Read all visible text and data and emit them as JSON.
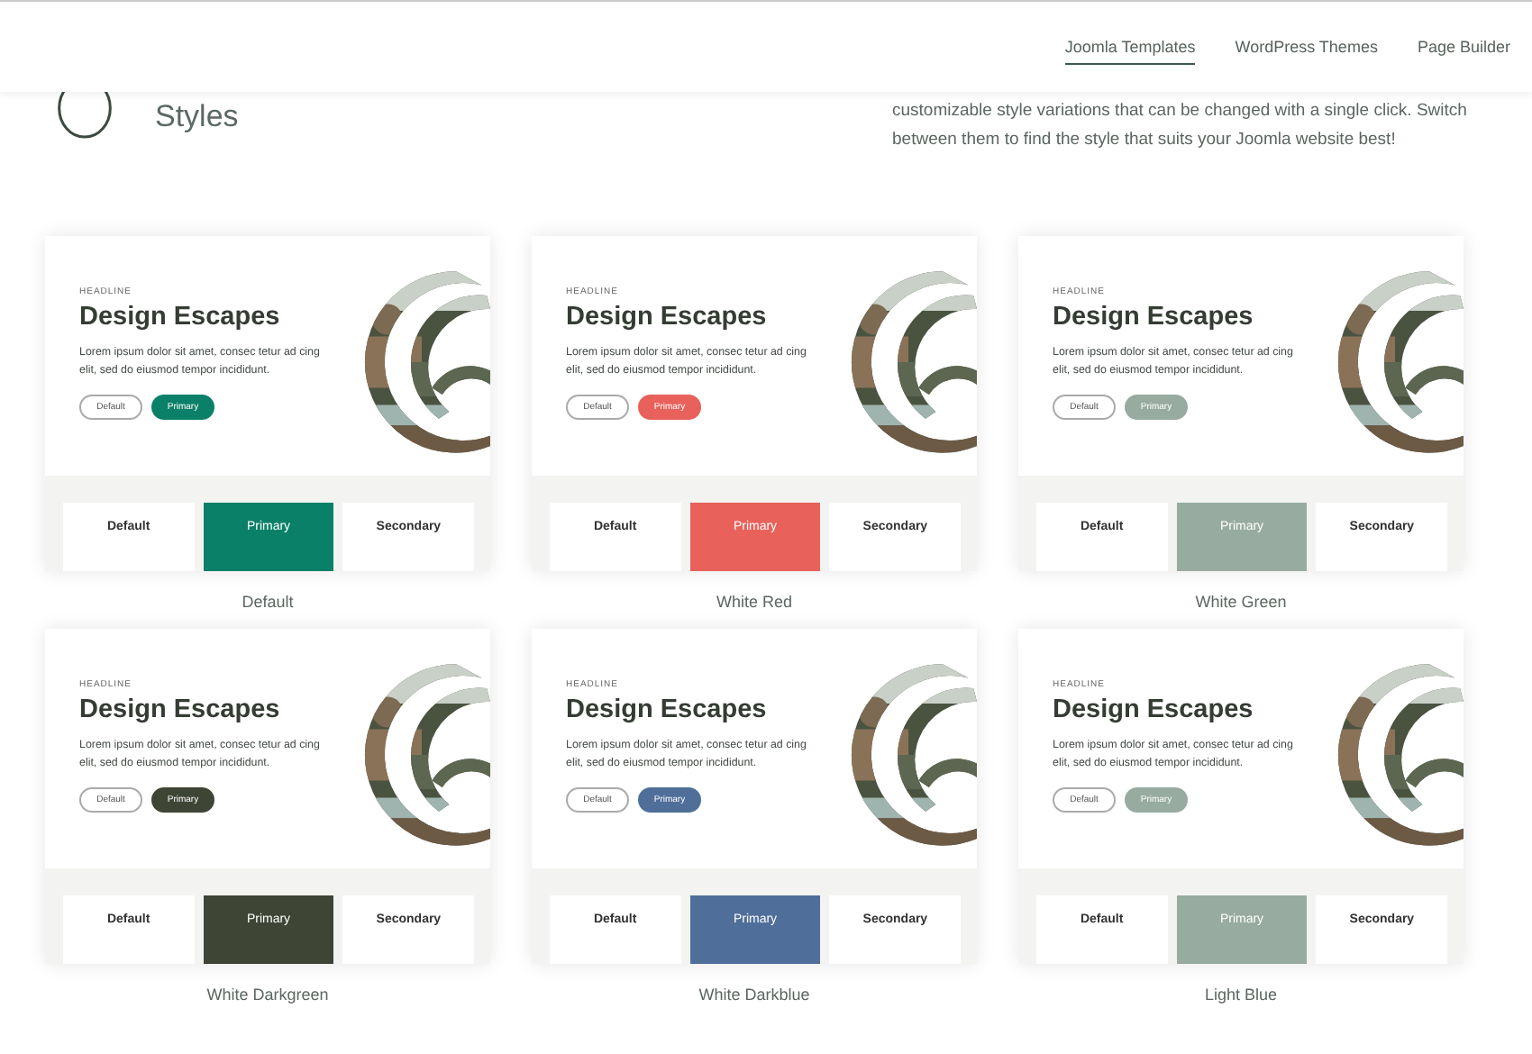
{
  "nav": [
    {
      "label": "Joomla Templates",
      "selected": true
    },
    {
      "label": "WordPress Themes",
      "selected": false
    },
    {
      "label": "Page Builder",
      "selected": false
    }
  ],
  "section": {
    "title": "Styles",
    "description": [
      "customizable style variations that can be changed with a single click. Switch",
      "between them to find the style that suits your Joomla website best!"
    ]
  },
  "styles": [
    {
      "name": "Default",
      "color": "#0b8068",
      "headline": "HEADLINE",
      "title": "Design Escapes",
      "body": "Lorem ipsum dolor sit amet, consec tetur ad cing elit, sed do eiusmod tempor incididunt.",
      "buttons": [
        {
          "label": "Default",
          "kind": "outline"
        },
        {
          "label": "Primary",
          "kind": "primary"
        }
      ],
      "swatches": [
        {
          "label": "Default",
          "kind": "plain"
        },
        {
          "label": "Primary",
          "kind": "primary"
        },
        {
          "label": "Secondary",
          "kind": "plain"
        }
      ]
    },
    {
      "name": "White Red",
      "color": "#e8615a",
      "headline": "HEADLINE",
      "title": "Design Escapes",
      "body": "Lorem ipsum dolor sit amet, consec tetur ad cing elit, sed do eiusmod tempor incididunt.",
      "buttons": [
        {
          "label": "Default",
          "kind": "outline"
        },
        {
          "label": "Primary",
          "kind": "primary"
        }
      ],
      "swatches": [
        {
          "label": "Default",
          "kind": "plain"
        },
        {
          "label": "Primary",
          "kind": "primary"
        },
        {
          "label": "Secondary",
          "kind": "plain"
        }
      ]
    },
    {
      "name": "White Green",
      "color": "#97aba0",
      "headline": "HEADLINE",
      "title": "Design Escapes",
      "body": "Lorem ipsum dolor sit amet, consec tetur ad cing elit, sed do eiusmod tempor incididunt.",
      "buttons": [
        {
          "label": "Default",
          "kind": "outline"
        },
        {
          "label": "Primary",
          "kind": "primary"
        }
      ],
      "swatches": [
        {
          "label": "Default",
          "kind": "plain"
        },
        {
          "label": "Primary",
          "kind": "primary"
        },
        {
          "label": "Secondary",
          "kind": "plain"
        }
      ]
    },
    {
      "name": "White Darkgreen",
      "color": "#3f4535",
      "headline": "HEADLINE",
      "title": "Design Escapes",
      "body": "Lorem ipsum dolor sit amet, consec tetur ad cing elit, sed do eiusmod tempor incididunt.",
      "buttons": [
        {
          "label": "Default",
          "kind": "outline"
        },
        {
          "label": "Primary",
          "kind": "primary"
        }
      ],
      "swatches": [
        {
          "label": "Default",
          "kind": "plain"
        },
        {
          "label": "Primary",
          "kind": "primary"
        },
        {
          "label": "Secondary",
          "kind": "plain"
        }
      ]
    },
    {
      "name": "White Darkblue",
      "color": "#4f6f9a",
      "headline": "HEADLINE",
      "title": "Design Escapes",
      "body": "Lorem ipsum dolor sit amet, consec tetur ad cing elit, sed do eiusmod tempor incididunt.",
      "buttons": [
        {
          "label": "Default",
          "kind": "outline"
        },
        {
          "label": "Primary",
          "kind": "primary"
        }
      ],
      "swatches": [
        {
          "label": "Default",
          "kind": "plain"
        },
        {
          "label": "Primary",
          "kind": "primary"
        },
        {
          "label": "Secondary",
          "kind": "plain"
        }
      ]
    },
    {
      "name": "Light Blue",
      "color": "#97aba0",
      "headline": "HEADLINE",
      "title": "Design Escapes",
      "body": "Lorem ipsum dolor sit amet, consec tetur ad cing elit, sed do eiusmod tempor incididunt.",
      "buttons": [
        {
          "label": "Default",
          "kind": "outline"
        },
        {
          "label": "Primary",
          "kind": "primary"
        }
      ],
      "swatches": [
        {
          "label": "Default",
          "kind": "plain"
        },
        {
          "label": "Primary",
          "kind": "primary"
        },
        {
          "label": "Secondary",
          "kind": "plain"
        }
      ]
    }
  ]
}
